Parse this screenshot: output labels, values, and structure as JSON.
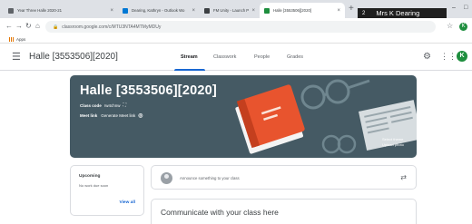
{
  "browser": {
    "tabs": [
      {
        "label": "Year Three Halle 2020-21",
        "fav_color": "#5f6368"
      },
      {
        "label": "Dearing, Kathryn - Outlook Wo",
        "fav_color": "#0078d4"
      },
      {
        "label": "FM Unity - Launch Pad",
        "fav_color": "#3c4043"
      },
      {
        "label": "Halle [3553506][2020]",
        "fav_color": "#1e8e3e"
      }
    ],
    "new_tab_icon": "+",
    "user_chip": {
      "badge": "2",
      "name": "Mrs K Dearing"
    },
    "window_controls": [
      "–",
      "□"
    ],
    "url": "classroom.google.com/c/MTU3NTA4MTMyMDUy",
    "profile_initial": "K",
    "bookmarks": [
      {
        "label": "Apps"
      }
    ]
  },
  "classroom": {
    "title": "Halle [3553506][2020]",
    "tabs": [
      "Stream",
      "Classwork",
      "People",
      "Grades"
    ],
    "active_tab": "Stream",
    "avatar_initial": "K"
  },
  "banner": {
    "title": "Halle [3553506][2020]",
    "class_code_label": "Class code",
    "class_code": "rw4chnw",
    "meet_label": "Meet link",
    "meet_action": "Generate Meet link",
    "select_theme": "Select theme",
    "upload_photo": "Upload photo",
    "bg_color": "#455a64"
  },
  "upcoming": {
    "title": "Upcoming",
    "empty_text": "No work due soon",
    "view_all": "View all"
  },
  "stream": {
    "announce_placeholder": "Announce something to your class",
    "communicate_title": "Communicate with your class here"
  },
  "icons": {
    "menu": "hamburger-icon",
    "settings": "gear-icon",
    "apps": "apps-grid-icon",
    "repost": "repost-icon",
    "video": "video-camera-icon",
    "fullscreen": "fullscreen-icon"
  }
}
